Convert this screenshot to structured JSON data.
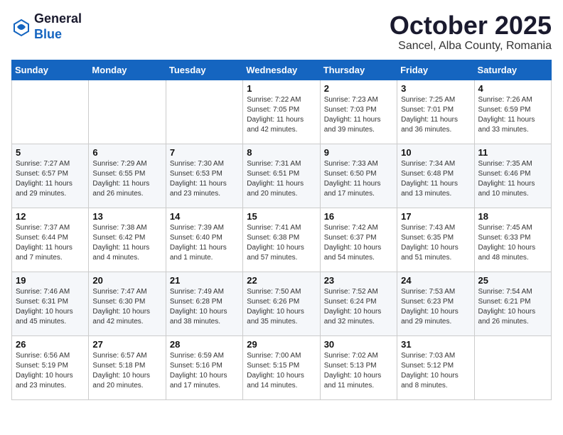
{
  "header": {
    "logo_line1": "General",
    "logo_line2": "Blue",
    "month": "October 2025",
    "location": "Sancel, Alba County, Romania"
  },
  "weekdays": [
    "Sunday",
    "Monday",
    "Tuesday",
    "Wednesday",
    "Thursday",
    "Friday",
    "Saturday"
  ],
  "weeks": [
    [
      {
        "day": "",
        "info": ""
      },
      {
        "day": "",
        "info": ""
      },
      {
        "day": "",
        "info": ""
      },
      {
        "day": "1",
        "info": "Sunrise: 7:22 AM\nSunset: 7:05 PM\nDaylight: 11 hours and 42 minutes."
      },
      {
        "day": "2",
        "info": "Sunrise: 7:23 AM\nSunset: 7:03 PM\nDaylight: 11 hours and 39 minutes."
      },
      {
        "day": "3",
        "info": "Sunrise: 7:25 AM\nSunset: 7:01 PM\nDaylight: 11 hours and 36 minutes."
      },
      {
        "day": "4",
        "info": "Sunrise: 7:26 AM\nSunset: 6:59 PM\nDaylight: 11 hours and 33 minutes."
      }
    ],
    [
      {
        "day": "5",
        "info": "Sunrise: 7:27 AM\nSunset: 6:57 PM\nDaylight: 11 hours and 29 minutes."
      },
      {
        "day": "6",
        "info": "Sunrise: 7:29 AM\nSunset: 6:55 PM\nDaylight: 11 hours and 26 minutes."
      },
      {
        "day": "7",
        "info": "Sunrise: 7:30 AM\nSunset: 6:53 PM\nDaylight: 11 hours and 23 minutes."
      },
      {
        "day": "8",
        "info": "Sunrise: 7:31 AM\nSunset: 6:51 PM\nDaylight: 11 hours and 20 minutes."
      },
      {
        "day": "9",
        "info": "Sunrise: 7:33 AM\nSunset: 6:50 PM\nDaylight: 11 hours and 17 minutes."
      },
      {
        "day": "10",
        "info": "Sunrise: 7:34 AM\nSunset: 6:48 PM\nDaylight: 11 hours and 13 minutes."
      },
      {
        "day": "11",
        "info": "Sunrise: 7:35 AM\nSunset: 6:46 PM\nDaylight: 11 hours and 10 minutes."
      }
    ],
    [
      {
        "day": "12",
        "info": "Sunrise: 7:37 AM\nSunset: 6:44 PM\nDaylight: 11 hours and 7 minutes."
      },
      {
        "day": "13",
        "info": "Sunrise: 7:38 AM\nSunset: 6:42 PM\nDaylight: 11 hours and 4 minutes."
      },
      {
        "day": "14",
        "info": "Sunrise: 7:39 AM\nSunset: 6:40 PM\nDaylight: 11 hours and 1 minute."
      },
      {
        "day": "15",
        "info": "Sunrise: 7:41 AM\nSunset: 6:38 PM\nDaylight: 10 hours and 57 minutes."
      },
      {
        "day": "16",
        "info": "Sunrise: 7:42 AM\nSunset: 6:37 PM\nDaylight: 10 hours and 54 minutes."
      },
      {
        "day": "17",
        "info": "Sunrise: 7:43 AM\nSunset: 6:35 PM\nDaylight: 10 hours and 51 minutes."
      },
      {
        "day": "18",
        "info": "Sunrise: 7:45 AM\nSunset: 6:33 PM\nDaylight: 10 hours and 48 minutes."
      }
    ],
    [
      {
        "day": "19",
        "info": "Sunrise: 7:46 AM\nSunset: 6:31 PM\nDaylight: 10 hours and 45 minutes."
      },
      {
        "day": "20",
        "info": "Sunrise: 7:47 AM\nSunset: 6:30 PM\nDaylight: 10 hours and 42 minutes."
      },
      {
        "day": "21",
        "info": "Sunrise: 7:49 AM\nSunset: 6:28 PM\nDaylight: 10 hours and 38 minutes."
      },
      {
        "day": "22",
        "info": "Sunrise: 7:50 AM\nSunset: 6:26 PM\nDaylight: 10 hours and 35 minutes."
      },
      {
        "day": "23",
        "info": "Sunrise: 7:52 AM\nSunset: 6:24 PM\nDaylight: 10 hours and 32 minutes."
      },
      {
        "day": "24",
        "info": "Sunrise: 7:53 AM\nSunset: 6:23 PM\nDaylight: 10 hours and 29 minutes."
      },
      {
        "day": "25",
        "info": "Sunrise: 7:54 AM\nSunset: 6:21 PM\nDaylight: 10 hours and 26 minutes."
      }
    ],
    [
      {
        "day": "26",
        "info": "Sunrise: 6:56 AM\nSunset: 5:19 PM\nDaylight: 10 hours and 23 minutes."
      },
      {
        "day": "27",
        "info": "Sunrise: 6:57 AM\nSunset: 5:18 PM\nDaylight: 10 hours and 20 minutes."
      },
      {
        "day": "28",
        "info": "Sunrise: 6:59 AM\nSunset: 5:16 PM\nDaylight: 10 hours and 17 minutes."
      },
      {
        "day": "29",
        "info": "Sunrise: 7:00 AM\nSunset: 5:15 PM\nDaylight: 10 hours and 14 minutes."
      },
      {
        "day": "30",
        "info": "Sunrise: 7:02 AM\nSunset: 5:13 PM\nDaylight: 10 hours and 11 minutes."
      },
      {
        "day": "31",
        "info": "Sunrise: 7:03 AM\nSunset: 5:12 PM\nDaylight: 10 hours and 8 minutes."
      },
      {
        "day": "",
        "info": ""
      }
    ]
  ]
}
